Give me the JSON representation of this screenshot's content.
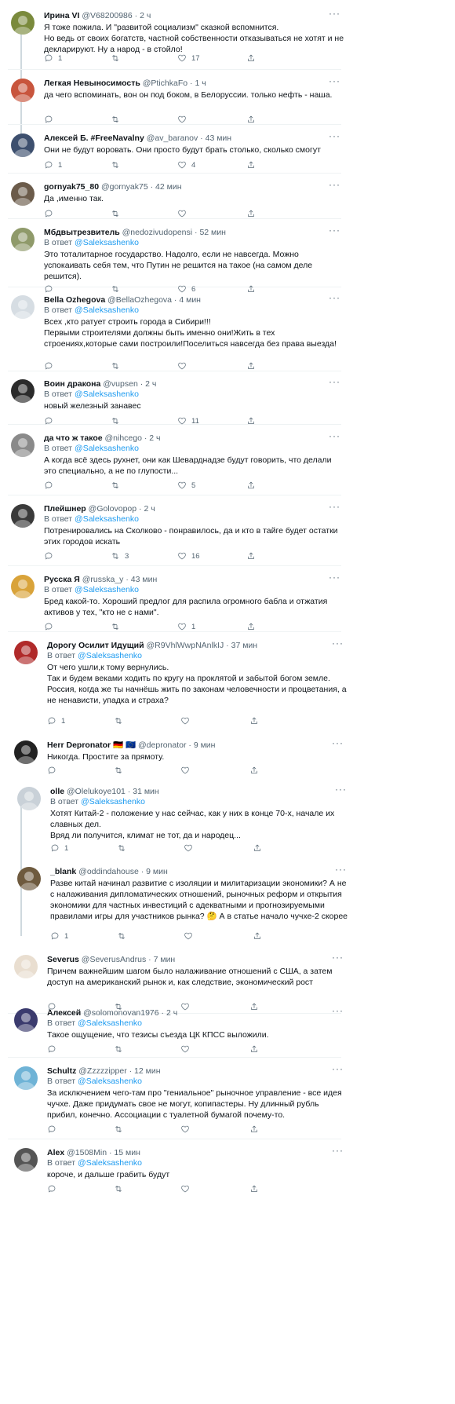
{
  "in_reply_prefix": "В ответ",
  "more_icon": "···",
  "tweets": [
    {
      "name": "Ирина VI",
      "handle": "@V68200986",
      "time": "2 ч",
      "reply_to": "",
      "text": "Я тоже пожила. И \"развитой социализм\" сказкой вспомнится.\nНо ведь от своих богатств, частной собственности отказываться не хотят и не декларируют. Ну а народ - в стойло!",
      "replies": "1",
      "retweets": "",
      "likes": "17"
    },
    {
      "name": "Легкая Невыносимость",
      "handle": "@PtichkaFo",
      "time": "1 ч",
      "reply_to": "",
      "text": "да чего вспоминать, вон он под боком, в Белоруссии. только нефть - наша.",
      "replies": "",
      "retweets": "",
      "likes": ""
    },
    {
      "name": "Алексей Б. #FreeNavalny",
      "handle": "@av_baranov",
      "time": "43 мин",
      "reply_to": "",
      "text": "Они не будут воровать. Они просто будут брать столько, сколько смогут",
      "replies": "1",
      "retweets": "",
      "likes": "4"
    },
    {
      "name": "gornyak75_80",
      "handle": "@gornyak75",
      "time": "42 мин",
      "reply_to": "",
      "text": "Да ,именно так.",
      "replies": "",
      "retweets": "",
      "likes": ""
    },
    {
      "name": "Мбдвытрезвитель",
      "handle": "@nedozivudopensi",
      "time": "52 мин",
      "reply_to": "@Saleksashenko",
      "text": "Это тоталитарное государство. Надолго, если не навсегда. Можно успокаивать себя тем, что Путин не решится на такое (на самом деле решится).",
      "replies": "",
      "retweets": "",
      "likes": "6"
    },
    {
      "name": "Bella Ozhegova",
      "handle": "@BellaOzhegova",
      "time": "4 мин",
      "reply_to": "@Saleksashenko",
      "text": "Всех ,кто ратует строить города в Сибири!!!\nПервыми строителями должны быть именно они!Жить в тех строениях,которые сами построили!Поселиться навсегда без права выезда!",
      "replies": "",
      "retweets": "",
      "likes": ""
    },
    {
      "name": "Воин дракона",
      "handle": "@vupsen",
      "time": "2 ч",
      "reply_to": "@Saleksashenko",
      "text": "новый железный занавес",
      "replies": "",
      "retweets": "",
      "likes": "11"
    },
    {
      "name": "да что ж такое",
      "handle": "@nihcego",
      "time": "2 ч",
      "reply_to": "@Saleksashenko",
      "text": "А когда всё здесь рухнет, они как Шеварднадзе будут говорить, что делали это специально, а не по глупости...",
      "replies": "",
      "retweets": "",
      "likes": "5"
    },
    {
      "name": "Плейшнер",
      "handle": "@Golovopop",
      "time": "2 ч",
      "reply_to": "@Saleksashenko",
      "text": "Потренировались на Сколково - понравилось, да и кто в тайге будет остатки этих городов искать",
      "replies": "",
      "retweets": "3",
      "likes": "16"
    },
    {
      "name": "Русска Я",
      "handle": "@russka_y",
      "time": "43 мин",
      "reply_to": "@Saleksashenko",
      "text": "Бред какой-то. Хороший предлог для распила огромного бабла и отжатия активов  у тех, \"кто не с нами\".",
      "replies": "",
      "retweets": "",
      "likes": "1"
    },
    {
      "name": "Дорогу Осилит Идущий",
      "handle": "@R9VhlWwpNAnlkIJ",
      "time": "37 мин",
      "reply_to": "@Saleksashenko",
      "text": "От чего ушли,к тому вернулись.\nТак и будем веками ходить по кругу  на проклятой и забытой богом земле.\nРоссия, когда же ты начнёшь жить по законам  человечности и процветания, а не ненависти, упадка и страха?",
      "replies": "1",
      "retweets": "",
      "likes": ""
    },
    {
      "name": "Herr Depronator 🇩🇪 🇪🇺",
      "handle": "@depronator",
      "time": "9 мин",
      "reply_to": "",
      "text": "Никогда. Простите за прямоту.",
      "replies": "",
      "retweets": "",
      "likes": ""
    },
    {
      "name": "olle",
      "handle": "@Olelukoye101",
      "time": "31 мин",
      "reply_to": "@Saleksashenko",
      "text": "Хотят Китай-2 - положение у нас сейчас, как у них в конце 70-х, начале их славных дел.\nВряд ли получится, климат не тот, да и народец...",
      "replies": "1",
      "retweets": "",
      "likes": ""
    },
    {
      "name": "_blank",
      "handle": "@oddindahouse",
      "time": "9 мин",
      "reply_to": "",
      "text": "Разве китай начинал развитие с изоляции и милитаризации экономики? А не с налаживания дипломатических отношений, рыночных реформ и открытия экономики для частных инвестиций с адекватными и прогнозируемыми правилами игры для участников рынка? 🤔 А в статье начало чучхе-2 скорее",
      "replies": "1",
      "retweets": "",
      "likes": ""
    },
    {
      "name": "Severus",
      "handle": "@SeverusAndrus",
      "time": "7 мин",
      "reply_to": "",
      "text": "Причем важнейшим шагом было налаживание отношений с США, а затем доступ на американский рынок и, как следствие, экономический рост",
      "replies": "",
      "retweets": "",
      "likes": ""
    },
    {
      "name": "Алексей",
      "handle": "@solomonovan1976",
      "time": "2 ч",
      "reply_to": "@Saleksashenko",
      "text": "Такое ощущение, что тезисы съезда ЦК КПСС выложили.",
      "replies": "",
      "retweets": "",
      "likes": ""
    },
    {
      "name": "Schultz",
      "handle": "@Zzzzzipper",
      "time": "12 мин",
      "reply_to": "@Saleksashenko",
      "text": "За исключением чего-там про \"гениальное\" рыночное управление - все идея чучхе. Даже придумать свое не могут, копипастеры. Ну длинный рубль прибил, конечно. Ассоциации с туалетной бумагой почему-то.",
      "replies": "",
      "retweets": "",
      "likes": ""
    },
    {
      "name": "Alex",
      "handle": "@1508Min",
      "time": "15 мин",
      "reply_to": "@Saleksashenko",
      "text": "короче, и дальше грабить будут",
      "replies": "",
      "retweets": "",
      "likes": ""
    }
  ],
  "avatar_colors": [
    "#7a8a3c",
    "#c8553d",
    "#3d4f6e",
    "#6b5b4a",
    "#8f9a6a",
    "#d6dde3",
    "#2b2b2b",
    "#8a8a8a",
    "#3a3a3a",
    "#d9a33a",
    "#b02a2a",
    "#222222",
    "#c9d1d8",
    "#6e5a3e",
    "#e9ded0",
    "#3b3b6e",
    "#6fb3d6",
    "#555555"
  ]
}
